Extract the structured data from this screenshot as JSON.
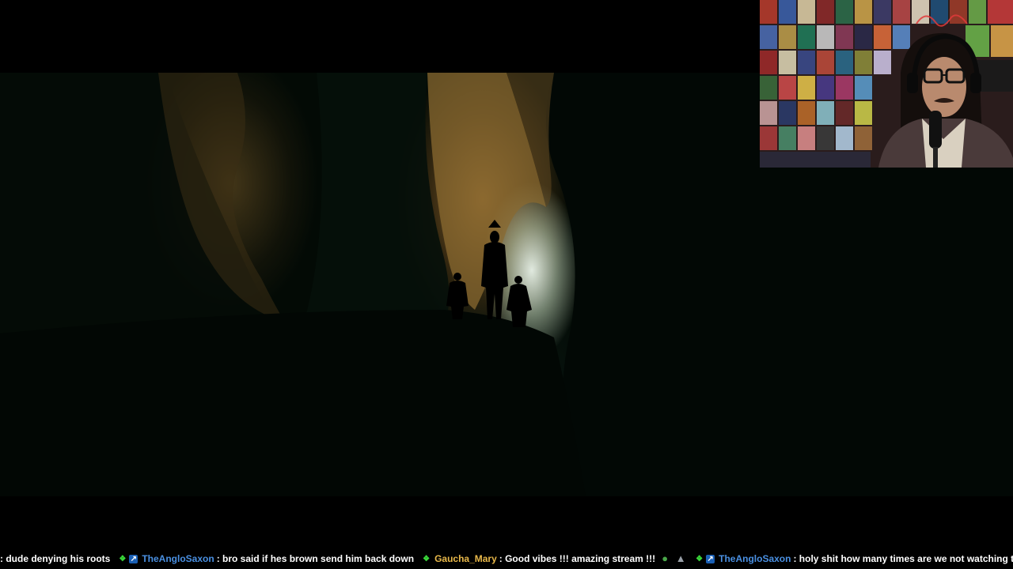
{
  "stream": {
    "chat_ticker": {
      "messages": [
        {
          "user": "",
          "user_color": "#ffffff",
          "badges": [],
          "text": ": dude denying his roots",
          "emotes": []
        },
        {
          "user": "TheAngloSaxon",
          "user_color": "#4a90e2",
          "badges": [
            "green-k-icon",
            "blue-arrow-icon"
          ],
          "text": ": bro said if hes brown send him back down",
          "emotes": []
        },
        {
          "user": "Gaucha_Mary",
          "user_color": "#e8b84a",
          "badges": [
            "green-k-icon"
          ],
          "text": ": Good vibes !!! amazing stream !!!",
          "emotes": [
            "pepe-emote-icon",
            "dog-emote-icon"
          ]
        },
        {
          "user": "TheAngloSaxon",
          "user_color": "#4a90e2",
          "badges": [
            "green-k-icon",
            "blue-arrow-icon"
          ],
          "text": ": holy shit how many times are we not watching this",
          "emotes": [
            "demon-emote-icon"
          ]
        }
      ]
    },
    "colors": {
      "background": "#000000",
      "badge_green": "#3adb3a",
      "badge_blue": "#1a5fb4"
    }
  }
}
